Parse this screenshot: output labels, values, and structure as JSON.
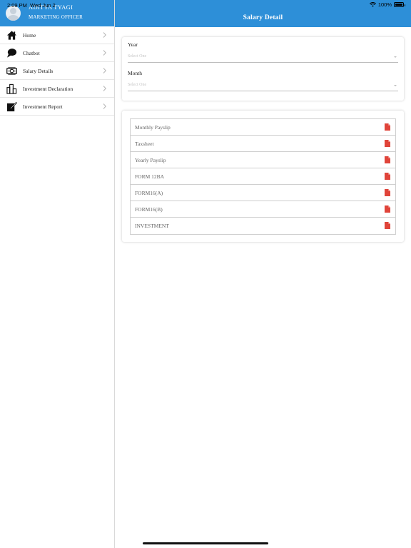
{
  "status_bar": {
    "time": "2:09 PM",
    "date": "Wed Jun 2",
    "battery": "100%"
  },
  "sidebar": {
    "user_name": "ADITYA TYAGI",
    "user_role": "MARKETING OFFICER",
    "items": [
      {
        "label": "Home",
        "icon": "home-icon"
      },
      {
        "label": "Chatbot",
        "icon": "chat-icon"
      },
      {
        "label": "Salary Details",
        "icon": "money-icon"
      },
      {
        "label": "Investment Declaration",
        "icon": "chart-icon"
      },
      {
        "label": "Investment Report",
        "icon": "edit-icon"
      }
    ]
  },
  "header": {
    "title": "Salary Detail"
  },
  "filters": {
    "year_label": "Year",
    "year_value": "Select One",
    "month_label": "Month",
    "month_value": "Select One"
  },
  "documents": [
    {
      "label": "Monthly Payslip",
      "icon": "pdf-icon"
    },
    {
      "label": "Taxsheet",
      "icon": "pdf-icon"
    },
    {
      "label": "Yearly Payslip",
      "icon": "pdf-icon"
    },
    {
      "label": "FORM 12BA",
      "icon": "pdf-icon"
    },
    {
      "label": "FORM16(A)",
      "icon": "pdf-icon"
    },
    {
      "label": "FORM16(B)",
      "icon": "pdf-icon"
    },
    {
      "label": "INVESTMENT",
      "icon": "pdf-icon"
    }
  ],
  "colors": {
    "primary": "#2d8fd8",
    "pdf_red": "#e0443a"
  }
}
